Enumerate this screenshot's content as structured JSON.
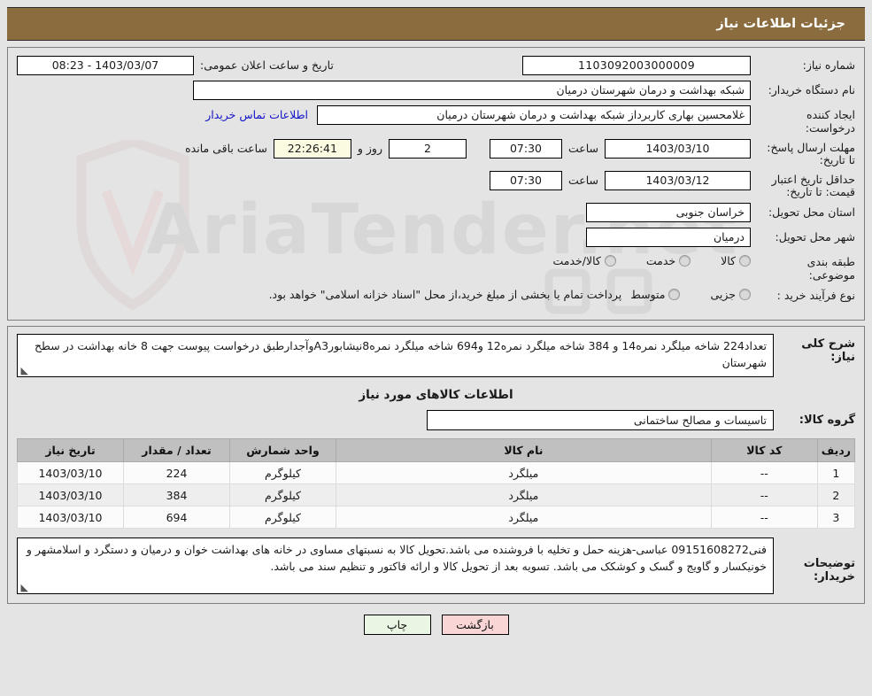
{
  "header": {
    "title": "جزئیات اطلاعات نیاز"
  },
  "form": {
    "need_number_label": "شماره نیاز:",
    "need_number": "1103092003000009",
    "public_announce_label": "تاریخ و ساعت اعلان عمومی:",
    "public_announce_value": "1403/03/07 - 08:23",
    "buyer_org_label": "نام دستگاه خریدار:",
    "buyer_org": "شبکه بهداشت و درمان شهرستان درمیان",
    "creator_label": "ایجاد کننده درخواست:",
    "creator": "غلامحسین بهاری کاربرداز شبکه بهداشت و درمان شهرستان درمیان",
    "contact_link": "اطلاعات تماس خریدار",
    "response_deadline_label": "مهلت ارسال پاسخ: تا تاریخ:",
    "response_deadline_date": "1403/03/10",
    "hour_label": "ساعت",
    "response_deadline_time": "07:30",
    "remaining_days": "2",
    "days_and_label": "روز و",
    "remaining_time": "22:26:41",
    "remaining_suffix": "ساعت باقی مانده",
    "price_validity_label": "حداقل تاریخ اعتبار قیمت: تا تاریخ:",
    "price_validity_date": "1403/03/12",
    "price_validity_time": "07:30",
    "province_label": "استان محل تحویل:",
    "province": "خراسان جنوبی",
    "city_label": "شهر محل تحویل:",
    "city": "درمیان",
    "category_label": "طبقه بندی موضوعی:",
    "category_options": [
      "کالا",
      "خدمت",
      "کالا/خدمت"
    ],
    "category_selected": "",
    "process_label": "نوع فرآیند خرید :",
    "process_options": [
      "جزیی",
      "متوسط"
    ],
    "process_selected": "",
    "payment_note": "پرداخت تمام یا بخشی از مبلغ خرید،از محل \"اسناد خزانه اسلامی\" خواهد بود."
  },
  "description": {
    "label": "شرح کلی نیاز:",
    "text": "تعداد224 شاخه میلگرد نمره14 و 384 شاخه میلگرد نمره12 و694 شاخه میلگرد نمره8نیشابورA3وآجدارطبق درخواست پیوست جهت 8 خانه بهداشت در سطح شهرستان"
  },
  "goods_section": {
    "heading": "اطلاعات کالاهای مورد نیاز",
    "group_label": "گروه کالا:",
    "group_value": "تاسیسات و مصالح ساختمانی"
  },
  "table": {
    "columns": [
      "ردیف",
      "کد کالا",
      "نام کالا",
      "واحد شمارش",
      "تعداد / مقدار",
      "تاریخ نیاز"
    ],
    "rows": [
      {
        "radif": "1",
        "code": "--",
        "name": "میلگرد",
        "unit": "کیلوگرم",
        "qty": "224",
        "date": "1403/03/10"
      },
      {
        "radif": "2",
        "code": "--",
        "name": "میلگرد",
        "unit": "کیلوگرم",
        "qty": "384",
        "date": "1403/03/10"
      },
      {
        "radif": "3",
        "code": "--",
        "name": "میلگرد",
        "unit": "کیلوگرم",
        "qty": "694",
        "date": "1403/03/10"
      }
    ]
  },
  "notes": {
    "label": "توضیحات خریدار:",
    "text": "فنی09151608272 عباسی-هزینه حمل و تخلیه با فروشنده می باشد.تحویل کالا به نسبتهای مساوی در خانه های بهداشت خوان و درمیان و دستگرد و اسلامشهر و خونیکسار و گاویج و گسک و کوشکک می باشد. تسویه بعد از تحویل کالا و ارائه فاکتور و تنظیم سند می باشد."
  },
  "footer": {
    "print_label": "چاپ",
    "back_label": "بازگشت"
  },
  "watermark": {
    "text": "AriaTender.net"
  },
  "colors": {
    "title_bar": "#8b6c3f",
    "link": "#1414c8",
    "print_button": "#eaf6e4",
    "back_button": "#f9d5d5",
    "table_header": "#c0c0c0",
    "page_background": "#e4e4e4"
  }
}
